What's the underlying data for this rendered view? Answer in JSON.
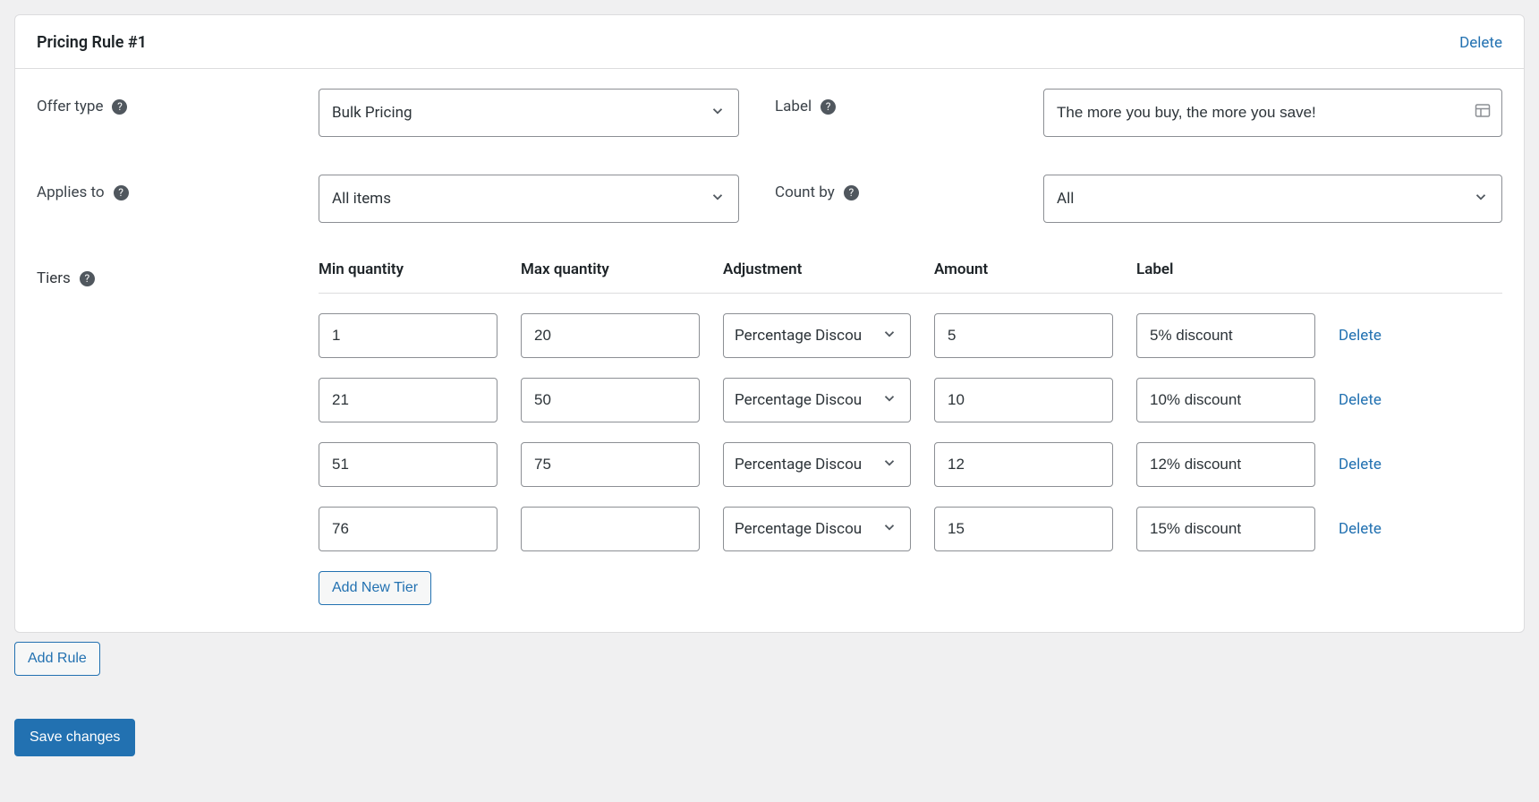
{
  "rule": {
    "title": "Pricing Rule #1",
    "delete_label": "Delete"
  },
  "fields": {
    "offer_type": {
      "label": "Offer type",
      "value": "Bulk Pricing"
    },
    "applies_to": {
      "label": "Applies to",
      "value": "All items"
    },
    "label_field": {
      "label": "Label",
      "value": "The more you buy, the more you save!"
    },
    "count_by": {
      "label": "Count by",
      "value": "All"
    },
    "tiers_label": "Tiers",
    "adjustment_option": "Percentage Discou"
  },
  "tiers": {
    "headers": {
      "min": "Min quantity",
      "max": "Max quantity",
      "adjustment": "Adjustment",
      "amount": "Amount",
      "label": "Label"
    },
    "rows": [
      {
        "min": "1",
        "max": "20",
        "adjustment": "Percentage Discou",
        "amount": "5",
        "label": "5% discount",
        "delete": "Delete"
      },
      {
        "min": "21",
        "max": "50",
        "adjustment": "Percentage Discou",
        "amount": "10",
        "label": "10% discount",
        "delete": "Delete"
      },
      {
        "min": "51",
        "max": "75",
        "adjustment": "Percentage Discou",
        "amount": "12",
        "label": "12% discount",
        "delete": "Delete"
      },
      {
        "min": "76",
        "max": "",
        "adjustment": "Percentage Discou",
        "amount": "15",
        "label": "15% discount",
        "delete": "Delete"
      }
    ],
    "add_tier_label": "Add New Tier"
  },
  "buttons": {
    "add_rule": "Add Rule",
    "save": "Save changes"
  }
}
